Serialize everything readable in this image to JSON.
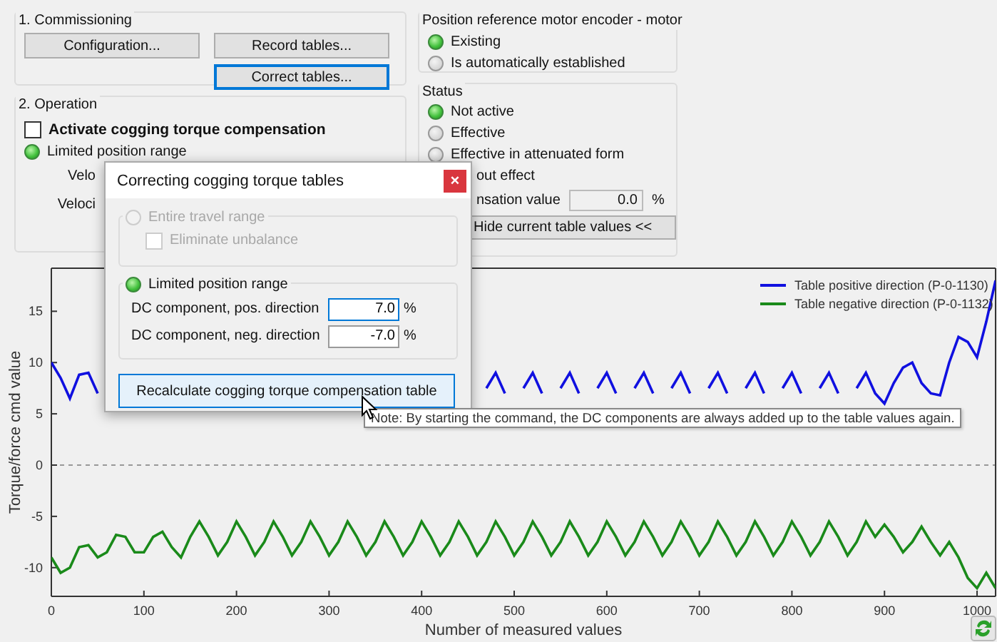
{
  "commissioning": {
    "title": "1. Commissioning",
    "buttons": [
      {
        "label": "Configuration...",
        "focused": false
      },
      {
        "label": "Record tables...",
        "focused": false
      },
      {
        "label": "Correct tables...",
        "focused": true
      }
    ]
  },
  "operation": {
    "title": "2. Operation",
    "checkbox": {
      "label": "Activate cogging torque compensation",
      "checked": false
    },
    "radio": {
      "label": "Limited position range",
      "selected": true
    },
    "covered_labels": [
      "Velo",
      "Veloci"
    ]
  },
  "position_reference": {
    "title": "Position reference motor encoder - motor",
    "options": [
      {
        "label": "Existing",
        "selected": true
      },
      {
        "label": "Is automatically established",
        "selected": false
      }
    ]
  },
  "status": {
    "title": "Status",
    "options": [
      {
        "kind": "radio",
        "label": "Not active",
        "selected": true
      },
      {
        "kind": "radio",
        "label": "Effective",
        "selected": false
      },
      {
        "kind": "radio",
        "label": "Effective in attenuated form",
        "selected": false
      },
      {
        "kind": "covered",
        "label": "out effect"
      }
    ],
    "compensation": {
      "label": "nsation value",
      "value": "0.0",
      "unit": "%"
    },
    "hide_button": "Hide current table values <<"
  },
  "dialog": {
    "title": "Correcting cogging torque tables",
    "close": "×",
    "entire_travel": {
      "label": "Entire travel range",
      "selected": false,
      "disabled": true
    },
    "eliminate_unbalance": {
      "label": "Eliminate unbalance",
      "checked": false,
      "disabled": true
    },
    "limited": {
      "label": "Limited position range",
      "selected": true
    },
    "fields": [
      {
        "label": "DC component, pos. direction",
        "value": "7.0",
        "unit": "%",
        "focused": true
      },
      {
        "label": "DC component, neg. direction",
        "value": "-7.0",
        "unit": "%",
        "focused": false
      }
    ],
    "button": {
      "label": "Recalculate cogging torque compensation table",
      "hovered": true
    }
  },
  "tooltip": "Note: By starting the command, the DC components are always added up to the table values again.",
  "chart": {
    "chart_data": {
      "type": "line",
      "legend": true,
      "xlabel": "Number of measured values",
      "ylabel": "Torque/force cmd value",
      "xlim": [
        0,
        1020
      ],
      "ylim": [
        -12.8,
        19.2
      ],
      "xticks": [
        0,
        100,
        200,
        300,
        400,
        500,
        600,
        700,
        800,
        900,
        1000
      ],
      "yticks": [
        -10,
        -5,
        0,
        5,
        10,
        15
      ],
      "x": [
        0,
        10,
        20,
        30,
        40,
        50,
        60,
        70,
        80,
        90,
        100,
        110,
        120,
        130,
        140,
        150,
        160,
        170,
        180,
        190,
        200,
        210,
        220,
        230,
        240,
        250,
        260,
        270,
        280,
        290,
        300,
        310,
        320,
        330,
        340,
        350,
        360,
        370,
        380,
        390,
        400,
        410,
        420,
        430,
        440,
        450,
        460,
        470,
        480,
        490,
        500,
        510,
        520,
        530,
        540,
        550,
        560,
        570,
        580,
        590,
        600,
        610,
        620,
        630,
        640,
        650,
        660,
        670,
        680,
        690,
        700,
        710,
        720,
        730,
        740,
        750,
        760,
        770,
        780,
        790,
        800,
        810,
        820,
        830,
        840,
        850,
        860,
        870,
        880,
        890,
        900,
        910,
        920,
        930,
        940,
        950,
        960,
        970,
        980,
        990,
        1000,
        1010,
        1020
      ],
      "series": [
        {
          "name": "Table positive direction (P-0-1130)",
          "color": "#1010e0",
          "values": [
            10,
            8.5,
            6.5,
            8.8,
            9,
            7,
            null,
            null,
            null,
            null,
            null,
            null,
            null,
            null,
            null,
            null,
            null,
            null,
            null,
            null,
            null,
            null,
            null,
            null,
            null,
            null,
            null,
            null,
            null,
            null,
            null,
            null,
            null,
            null,
            null,
            null,
            null,
            null,
            null,
            null,
            null,
            null,
            null,
            null,
            null,
            null,
            null,
            7.5,
            9,
            7,
            null,
            7.5,
            9,
            7,
            null,
            7.5,
            9,
            7,
            null,
            7.5,
            9,
            7,
            null,
            7.5,
            9,
            7,
            null,
            7.5,
            9,
            7,
            null,
            7.5,
            9,
            7,
            null,
            7.5,
            9,
            7,
            null,
            7.5,
            9,
            7,
            null,
            7.5,
            9,
            7,
            null,
            7.5,
            9,
            7,
            6,
            8,
            9.5,
            10,
            8,
            7,
            6.8,
            10,
            12.5,
            12,
            10.5,
            14,
            18
          ]
        },
        {
          "name": "Table negative direction (P-0-1132)",
          "color": "#1a8a1a",
          "values": [
            -9,
            -10.5,
            -10,
            -8,
            -7.8,
            -9,
            -8.5,
            -6.8,
            -7,
            -8.5,
            -8.5,
            -7,
            -6.5,
            -8,
            -9,
            -7,
            -5.5,
            -7,
            -8.8,
            -7.5,
            -5.5,
            -7,
            -8.8,
            -7.5,
            -5.5,
            -7,
            -8.8,
            -7.5,
            -5.5,
            -7,
            -8.8,
            -7.5,
            -5.5,
            -7,
            -8.8,
            -7.5,
            -5.5,
            -7,
            -8.8,
            -7.5,
            -5.5,
            -7,
            -8.8,
            -7.5,
            -5.5,
            -7,
            -8.8,
            -7.5,
            -5.5,
            -7,
            -8.8,
            -7.5,
            -5.5,
            -7,
            -8.8,
            -7.5,
            -5.5,
            -7,
            -8.8,
            -7.5,
            -5.5,
            -7,
            -8.8,
            -7.5,
            -5.5,
            -7,
            -8.8,
            -7.5,
            -5.5,
            -7,
            -8.8,
            -7.5,
            -5.5,
            -7,
            -8.8,
            -7.5,
            -5.5,
            -7,
            -8.8,
            -7.5,
            -5.5,
            -7,
            -8.8,
            -7.5,
            -5.5,
            -7,
            -8.8,
            -7.5,
            -5.5,
            -7,
            -5.8,
            -7,
            -8.5,
            -7.5,
            -6,
            -7.5,
            -8.8,
            -7.5,
            -9,
            -11,
            -12,
            -10.5,
            -12
          ]
        }
      ]
    }
  }
}
